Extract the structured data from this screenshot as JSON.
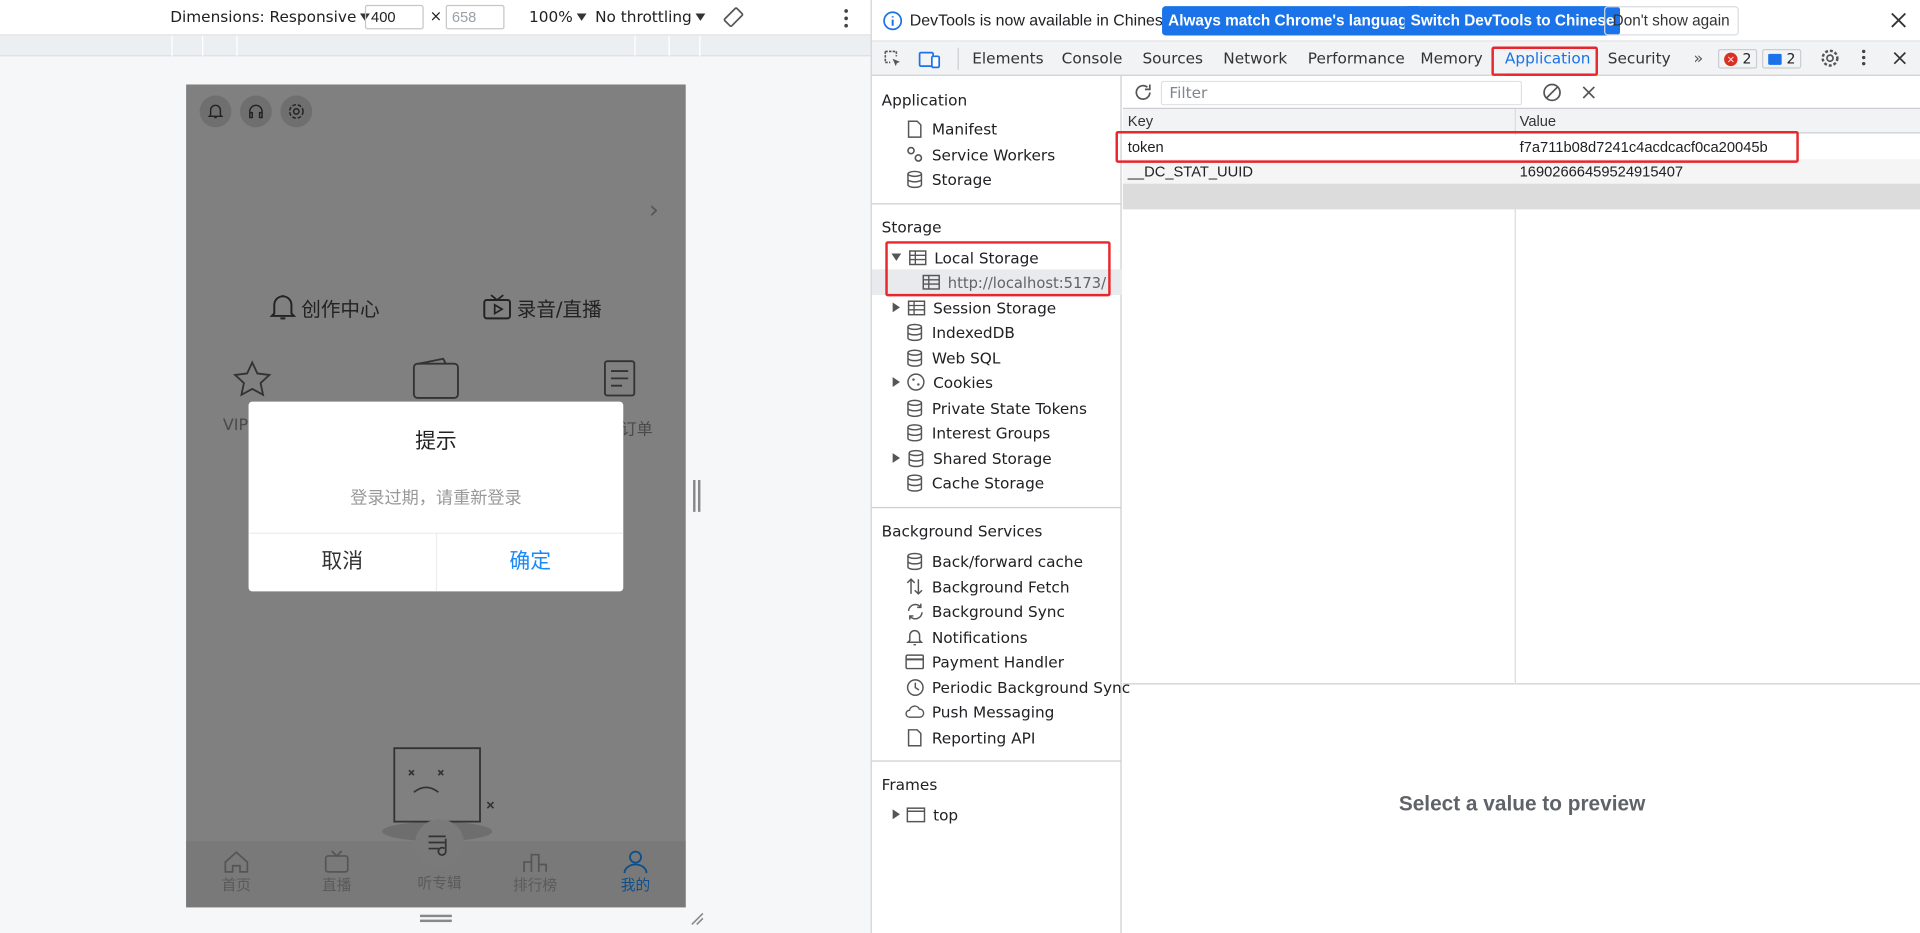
{
  "device_toolbar": {
    "dimensions_label": "Dimensions: Responsive",
    "width_value": "400",
    "times": "×",
    "height_value": "658",
    "zoom": "100%",
    "throttle": "No throttling"
  },
  "phone": {
    "header_icons": [
      "bell-icon",
      "headset-icon",
      "settings-icon"
    ],
    "chevron": "›",
    "entries": [
      {
        "label": "创作中心",
        "icon": "bell-icon"
      },
      {
        "label": "录音/直播",
        "icon": "tv-icon"
      }
    ],
    "grid_labels": [
      "VIP",
      "订单"
    ],
    "dialog": {
      "title": "提示",
      "message": "登录过期，请重新登录",
      "cancel": "取消",
      "confirm": "确定"
    },
    "tabbar": [
      {
        "label": "首页",
        "icon": "home-icon"
      },
      {
        "label": "直播",
        "icon": "tv-icon"
      },
      {
        "label": "听专辑",
        "icon": "album-icon"
      },
      {
        "label": "排行榜",
        "icon": "ranking-icon"
      },
      {
        "label": "我的",
        "icon": "user-icon"
      }
    ]
  },
  "devtools": {
    "info": {
      "text": "DevTools is now available in Chinese!",
      "btn_match": "Always match Chrome's language",
      "btn_switch": "Switch DevTools to Chinese",
      "btn_dismiss": "Don't show again"
    },
    "tabs": [
      "Elements",
      "Console",
      "Sources",
      "Network",
      "Performance",
      "Memory",
      "Application",
      "Security"
    ],
    "active_tab": "Application",
    "errors_count": "2",
    "messages_count": "2",
    "sidebar": {
      "application": {
        "heading": "Application",
        "items": [
          {
            "label": "Manifest",
            "icon": "document-icon"
          },
          {
            "label": "Service Workers",
            "icon": "gears-icon"
          },
          {
            "label": "Storage",
            "icon": "database-icon"
          }
        ]
      },
      "storage": {
        "heading": "Storage",
        "local_storage": "Local Storage",
        "local_storage_origin": "http://localhost:5173/",
        "items": [
          {
            "label": "Session Storage",
            "icon": "table-icon",
            "expandable": true
          },
          {
            "label": "IndexedDB",
            "icon": "database-icon",
            "expandable": false
          },
          {
            "label": "Web SQL",
            "icon": "database-icon",
            "expandable": false
          },
          {
            "label": "Cookies",
            "icon": "cookie-icon",
            "expandable": true
          },
          {
            "label": "Private State Tokens",
            "icon": "database-icon",
            "expandable": false
          },
          {
            "label": "Interest Groups",
            "icon": "database-icon",
            "expandable": false
          },
          {
            "label": "Shared Storage",
            "icon": "database-icon",
            "expandable": true
          },
          {
            "label": "Cache Storage",
            "icon": "database-icon",
            "expandable": false
          }
        ]
      },
      "background": {
        "heading": "Background Services",
        "items": [
          {
            "label": "Back/forward cache",
            "icon": "database-icon"
          },
          {
            "label": "Background Fetch",
            "icon": "arrows-updown-icon"
          },
          {
            "label": "Background Sync",
            "icon": "sync-icon"
          },
          {
            "label": "Notifications",
            "icon": "bell-icon"
          },
          {
            "label": "Payment Handler",
            "icon": "card-icon"
          },
          {
            "label": "Periodic Background Sync",
            "icon": "clock-icon"
          },
          {
            "label": "Push Messaging",
            "icon": "cloud-icon"
          },
          {
            "label": "Reporting API",
            "icon": "document-icon"
          }
        ]
      },
      "frames": {
        "heading": "Frames",
        "top": "top"
      }
    },
    "filter_placeholder": "Filter",
    "table": {
      "col_key": "Key",
      "col_value": "Value",
      "rows": [
        {
          "key": "token",
          "value": "f7a711b08d7241c4acdcacf0ca20045b"
        },
        {
          "key": "__DC_STAT_UUID",
          "value": "16902666459524915407"
        }
      ]
    },
    "preview_text": "Select a value to preview"
  },
  "colors": {
    "accent": "#1a73e8",
    "highlight": "#e8262b",
    "dialog_confirm": "#1989fa"
  }
}
